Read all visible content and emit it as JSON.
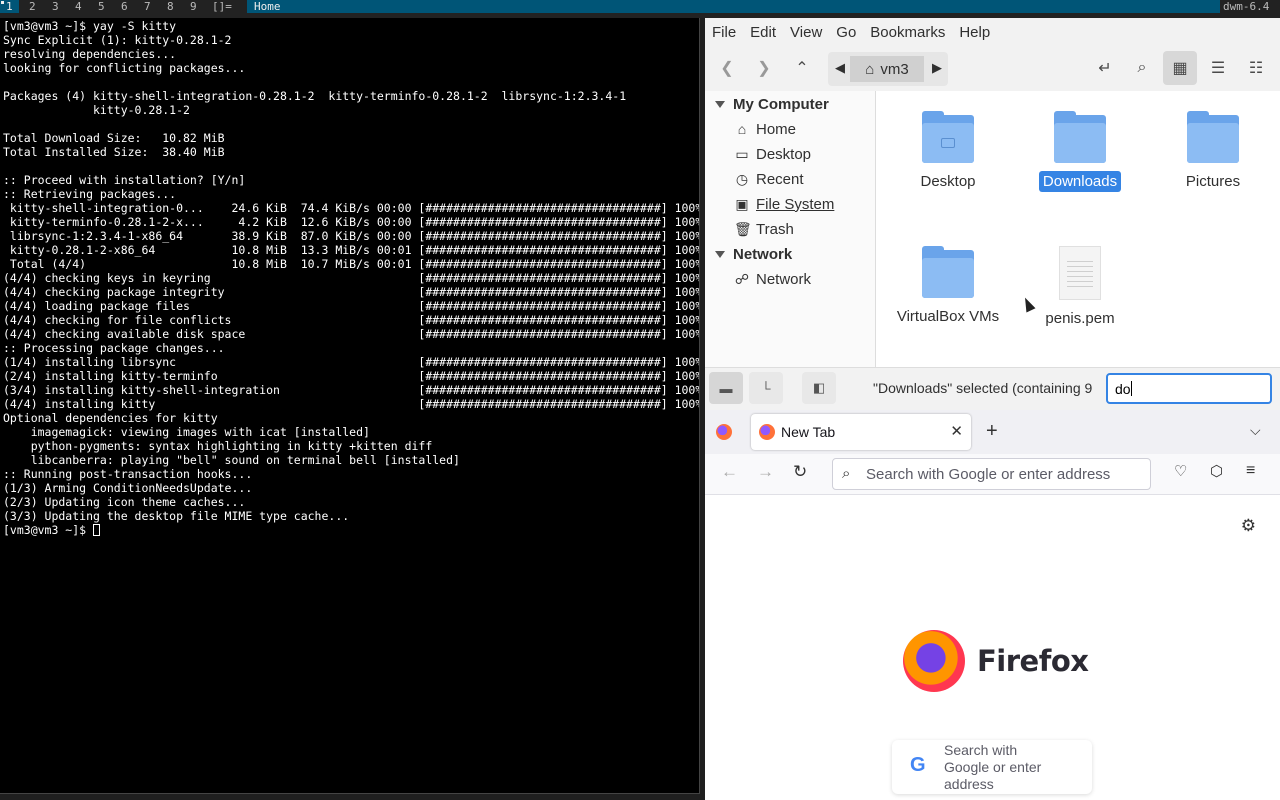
{
  "bar": {
    "tags": [
      "1",
      "2",
      "3",
      "4",
      "5",
      "6",
      "7",
      "8",
      "9"
    ],
    "layout": "[]=",
    "title": "Home",
    "status": "dwm-6.4"
  },
  "terminal": {
    "lines": [
      "[vm3@vm3 ~]$ yay -S kitty",
      "Sync Explicit (1): kitty-0.28.1-2",
      "resolving dependencies...",
      "looking for conflicting packages...",
      "",
      "Packages (4) kitty-shell-integration-0.28.1-2  kitty-terminfo-0.28.1-2  librsync-1:2.3.4-1",
      "             kitty-0.28.1-2",
      "",
      "Total Download Size:   10.82 MiB",
      "Total Installed Size:  38.40 MiB",
      "",
      ":: Proceed with installation? [Y/n]",
      ":: Retrieving packages...",
      " kitty-shell-integration-0...    24.6 KiB  74.4 KiB/s 00:00 [##################################] 100%",
      " kitty-terminfo-0.28.1-2-x...     4.2 KiB  12.6 KiB/s 00:00 [##################################] 100%",
      " librsync-1:2.3.4-1-x86_64       38.9 KiB  87.0 KiB/s 00:00 [##################################] 100%",
      " kitty-0.28.1-2-x86_64           10.8 MiB  13.3 MiB/s 00:01 [##################################] 100%",
      " Total (4/4)                     10.8 MiB  10.7 MiB/s 00:01 [##################################] 100%",
      "(4/4) checking keys in keyring                              [##################################] 100%",
      "(4/4) checking package integrity                            [##################################] 100%",
      "(4/4) loading package files                                 [##################################] 100%",
      "(4/4) checking for file conflicts                           [##################################] 100%",
      "(4/4) checking available disk space                         [##################################] 100%",
      ":: Processing package changes...",
      "(1/4) installing librsync                                   [##################################] 100%",
      "(2/4) installing kitty-terminfo                             [##################################] 100%",
      "(3/4) installing kitty-shell-integration                    [##################################] 100%",
      "(4/4) installing kitty                                      [##################################] 100%",
      "Optional dependencies for kitty",
      "    imagemagick: viewing images with icat [installed]",
      "    python-pygments: syntax highlighting in kitty +kitten diff",
      "    libcanberra: playing \"bell\" sound on terminal bell [installed]",
      ":: Running post-transaction hooks...",
      "(1/3) Arming ConditionNeedsUpdate...",
      "(2/3) Updating icon theme caches...",
      "(3/3) Updating the desktop file MIME type cache...",
      "[vm3@vm3 ~]$ "
    ]
  },
  "fm": {
    "menu": [
      "File",
      "Edit",
      "View",
      "Go",
      "Bookmarks",
      "Help"
    ],
    "path": "vm3",
    "sidebar": {
      "my_computer": "My Computer",
      "home": "Home",
      "desktop": "Desktop",
      "recent": "Recent",
      "filesystem": "File System",
      "trash": "Trash",
      "network_head": "Network",
      "network": "Network"
    },
    "items": {
      "desktop": "Desktop",
      "downloads": "Downloads",
      "pictures": "Pictures",
      "virtualbox": "VirtualBox VMs",
      "pem": "penis.pem"
    },
    "status": "\"Downloads\" selected (containing 9",
    "typeahead": "do",
    "colors": {
      "selection": "#3584e4",
      "folder": "#6aa4ea"
    }
  },
  "ff": {
    "tab": "New Tab",
    "url_placeholder": "Search with Google or enter address",
    "brand": "Firefox",
    "search_placeholder": "Search with Google or enter address"
  }
}
